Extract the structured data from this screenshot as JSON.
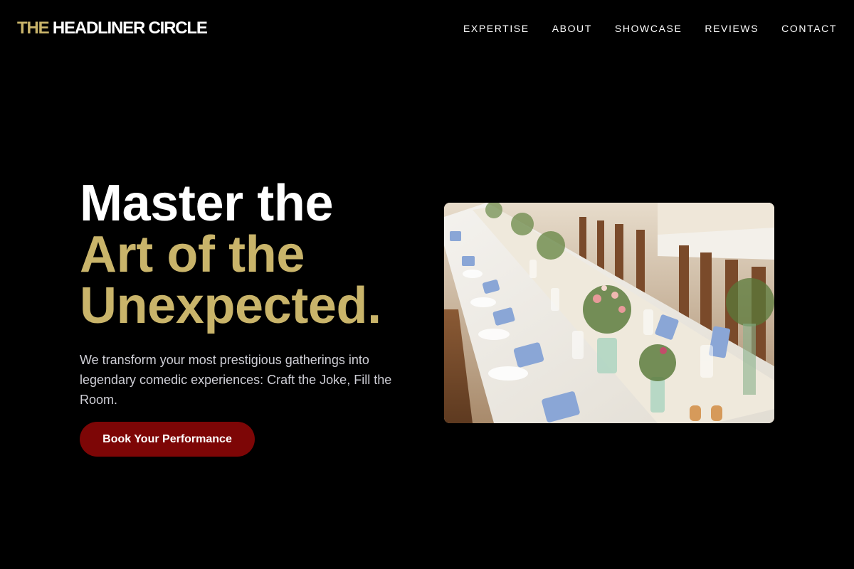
{
  "brand": {
    "accent": "THE",
    "name": "HEADLINER CIRCLE",
    "accent_color": "#c9b46a"
  },
  "nav": {
    "items": [
      {
        "label": "EXPERTISE"
      },
      {
        "label": "ABOUT"
      },
      {
        "label": "SHOWCASE"
      },
      {
        "label": "REVIEWS"
      },
      {
        "label": "CONTACT"
      }
    ]
  },
  "hero": {
    "headline_line1": "Master the",
    "headline_line2": "Art of the",
    "headline_line3": "Unexpected.",
    "subtext": "We transform your most prestigious gatherings into legendary comedic experiences: Craft the Joke, Fill the Room.",
    "cta_label": "Book Your Performance",
    "cta_color": "#7d0606",
    "image_icon": "banquet-table-photo"
  }
}
